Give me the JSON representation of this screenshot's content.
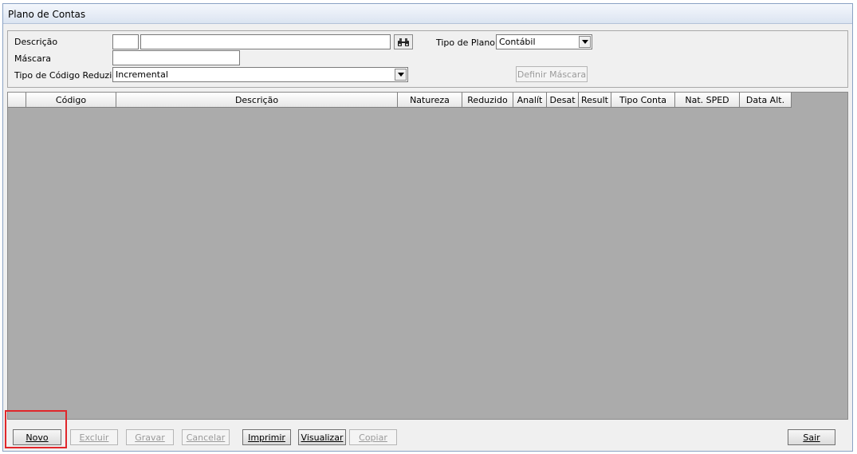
{
  "window": {
    "title": "Plano de Contas"
  },
  "form": {
    "descricao_label": "Descrição",
    "descricao_code_value": "",
    "descricao_text_value": "",
    "mascara_label": "Máscara",
    "mascara_value": "",
    "tipo_codigo_label": "Tipo de Código Reduzido",
    "tipo_codigo_value": "Incremental",
    "tipo_plano_label": "Tipo de Plano:",
    "tipo_plano_value": "Contábil",
    "definir_mascara_label": "Definir Máscara"
  },
  "grid": {
    "columns": [
      "",
      "Código",
      "Descrição",
      "Natureza",
      "Reduzido",
      "Analít",
      "Desat",
      "Result",
      "Tipo Conta",
      "Nat. SPED",
      "Data Alt."
    ],
    "rows": []
  },
  "toolbar": {
    "novo": "Novo",
    "excluir": "Excluir",
    "gravar": "Gravar",
    "cancelar": "Cancelar",
    "imprimir": "Imprimir",
    "visualizar": "Visualizar",
    "copiar": "Copiar",
    "sair": "Sair"
  },
  "icons": {
    "search": "binoculars-icon",
    "dropdown": "chevron-down-icon"
  },
  "colors": {
    "grid_background": "#ababab",
    "highlight": "#e0262b"
  }
}
